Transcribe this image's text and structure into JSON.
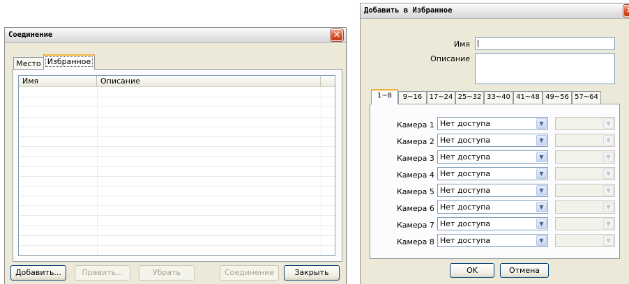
{
  "connection_window": {
    "title": "Соединение",
    "tabs": [
      {
        "label": "Место",
        "active": false
      },
      {
        "label": "Избранное",
        "active": true
      }
    ],
    "columns": [
      "Имя",
      "Описание"
    ],
    "buttons": {
      "add": "Добавить...",
      "edit": "Править...",
      "remove": "Убрать",
      "connect": "Соединение",
      "close": "Закрыть"
    }
  },
  "favorites_dialog": {
    "title": "Добавить в Избранное",
    "name_label": "Имя",
    "name_value": "",
    "description_label": "Описание",
    "description_value": "",
    "tabs": [
      "1~8",
      "9~16",
      "17~24",
      "25~32",
      "33~40",
      "41~48",
      "49~56",
      "57~64"
    ],
    "active_tab": "1~8",
    "cameras": [
      {
        "label": "Камера 1",
        "access": "Нет доступа"
      },
      {
        "label": "Камера 2",
        "access": "Нет доступа"
      },
      {
        "label": "Камера 3",
        "access": "Нет доступа"
      },
      {
        "label": "Камера 4",
        "access": "Нет доступа"
      },
      {
        "label": "Камера 5",
        "access": "Нет доступа"
      },
      {
        "label": "Камера 6",
        "access": "Нет доступа"
      },
      {
        "label": "Камера 7",
        "access": "Нет доступа"
      },
      {
        "label": "Камера 8",
        "access": "Нет доступа"
      }
    ],
    "ok_label": "OK",
    "cancel_label": "Отмена"
  },
  "icons": {
    "close": "close-icon",
    "dropdown": "chevron-down-icon"
  },
  "colors": {
    "close_button": "#d9512c",
    "tab_highlight": "#f4b239",
    "button_border": "#003c74"
  }
}
